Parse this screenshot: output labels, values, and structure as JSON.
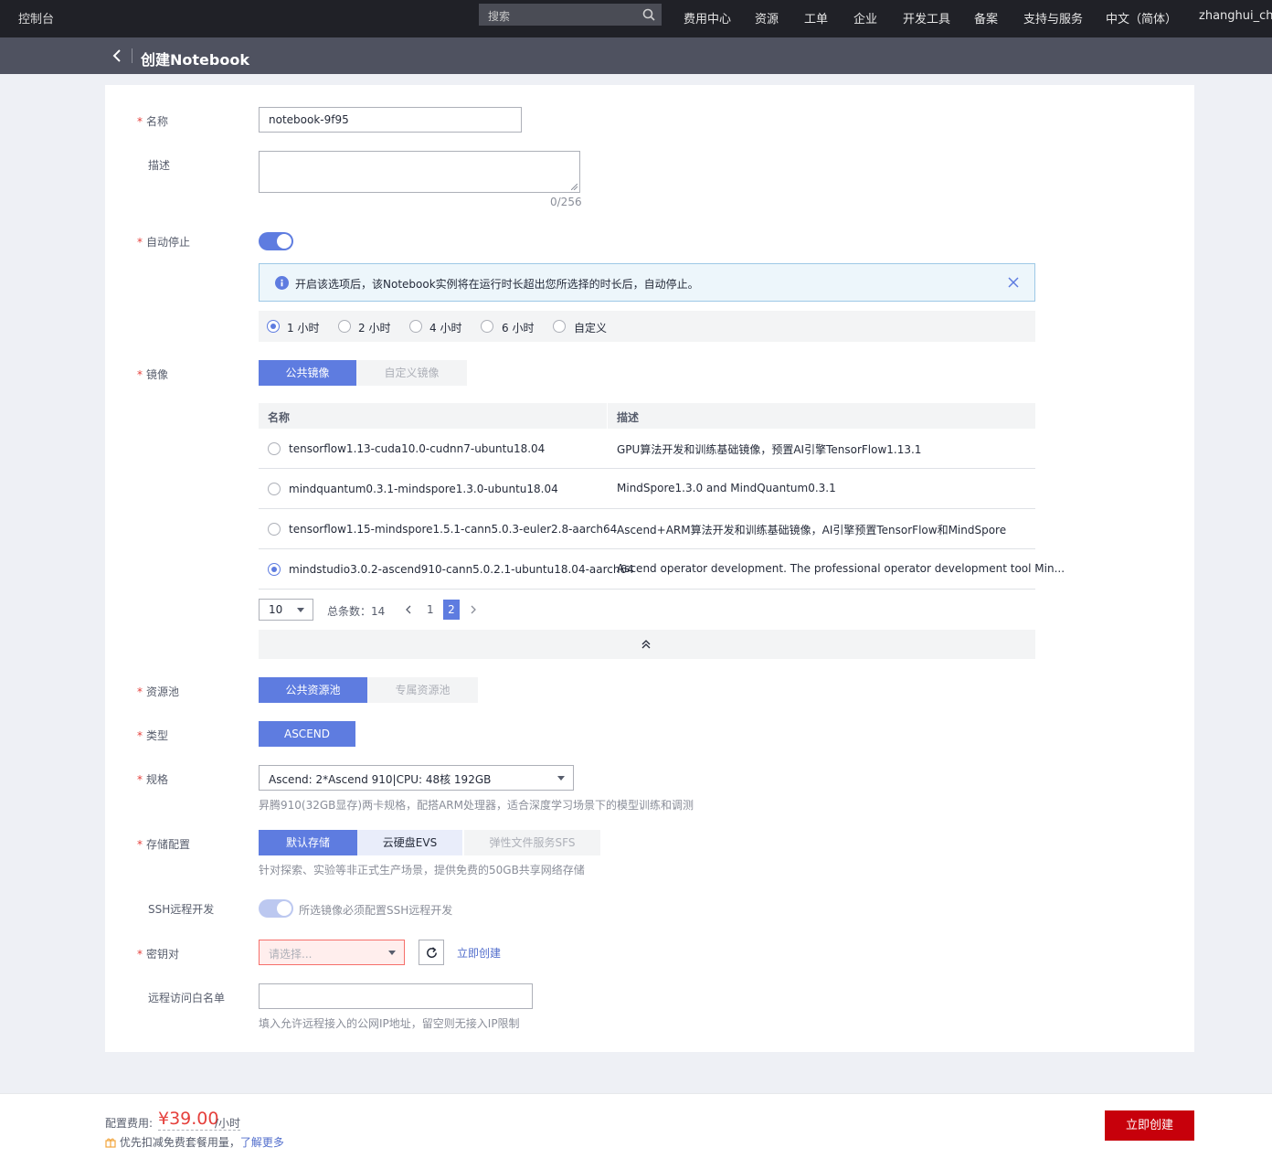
{
  "topbar": {
    "console": "控制台",
    "search_placeholder": "搜索",
    "nav": [
      "费用中心",
      "资源",
      "工单",
      "企业",
      "开发工具",
      "备案",
      "支持与服务",
      "中文（简体）",
      "zhanghui_chin"
    ]
  },
  "header": {
    "title": "创建Notebook"
  },
  "form": {
    "name": {
      "label": "名称",
      "value": "notebook-9f95"
    },
    "description": {
      "label": "描述",
      "value": "",
      "counter": "0/256"
    },
    "auto_stop": {
      "label": "自动停止",
      "enabled": true,
      "info": "开启该选项后，该Notebook实例将在运行时长超出您所选择的时长后，自动停止。",
      "options": [
        "1 小时",
        "2 小时",
        "4 小时",
        "6 小时",
        "自定义"
      ],
      "selected": "1 小时"
    },
    "image": {
      "label": "镜像",
      "tabs": [
        "公共镜像",
        "自定义镜像"
      ],
      "active_tab": "公共镜像",
      "columns": [
        "名称",
        "描述"
      ],
      "rows": [
        {
          "name": "tensorflow1.13-cuda10.0-cudnn7-ubuntu18.04",
          "desc": "GPU算法开发和训练基础镜像，预置AI引擎TensorFlow1.13.1",
          "selected": false
        },
        {
          "name": "mindquantum0.3.1-mindspore1.3.0-ubuntu18.04",
          "desc": "MindSpore1.3.0 and MindQuantum0.3.1",
          "selected": false
        },
        {
          "name": "tensorflow1.15-mindspore1.5.1-cann5.0.3-euler2.8-aarch64",
          "desc": "Ascend+ARM算法开发和训练基础镜像，AI引擎预置TensorFlow和MindSpore",
          "selected": false
        },
        {
          "name": "mindstudio3.0.2-ascend910-cann5.0.2.1-ubuntu18.04-aarch64",
          "desc": "Ascend operator development. The professional operator development tool Min...",
          "selected": true
        }
      ],
      "pager": {
        "page_size": "10",
        "total_label": "总条数：",
        "total": "14",
        "pages": [
          "1",
          "2"
        ],
        "current": "2"
      }
    },
    "pool": {
      "label": "资源池",
      "tabs": [
        "公共资源池",
        "专属资源池"
      ],
      "active_tab": "公共资源池"
    },
    "type": {
      "label": "类型",
      "value": "ASCEND"
    },
    "spec": {
      "label": "规格",
      "value": "Ascend: 2*Ascend 910|CPU: 48核 192GB",
      "help": "昇腾910(32GB显存)两卡规格，配搭ARM处理器，适合深度学习场景下的模型训练和调测"
    },
    "storage": {
      "label": "存储配置",
      "tabs": [
        "默认存储",
        "云硬盘EVS",
        "弹性文件服务SFS"
      ],
      "active_tab": "默认存储",
      "help": "针对探索、实验等非正式生产场景，提供免费的50GB共享网络存储"
    },
    "ssh": {
      "label": "SSH远程开发",
      "note": "所选镜像必须配置SSH远程开发"
    },
    "keypair": {
      "label": "密钥对",
      "placeholder": "请选择...",
      "create_link": "立即创建"
    },
    "whitelist": {
      "label": "远程访问白名单",
      "value": "",
      "help": "填入允许远程接入的公网IP地址，留空则无接入IP限制"
    }
  },
  "footer": {
    "fee_label": "配置费用:",
    "price": "¥39.00",
    "unit": "/小时",
    "promo_text": "优先扣减免费套餐用量，",
    "promo_link": "了解更多",
    "create_button": "立即创建"
  },
  "colors": {
    "accent": "#5e7ce0",
    "danger": "#e5403c",
    "brand_button": "#c7000b",
    "topbar": "#202127",
    "subbar": "#4f5260"
  }
}
